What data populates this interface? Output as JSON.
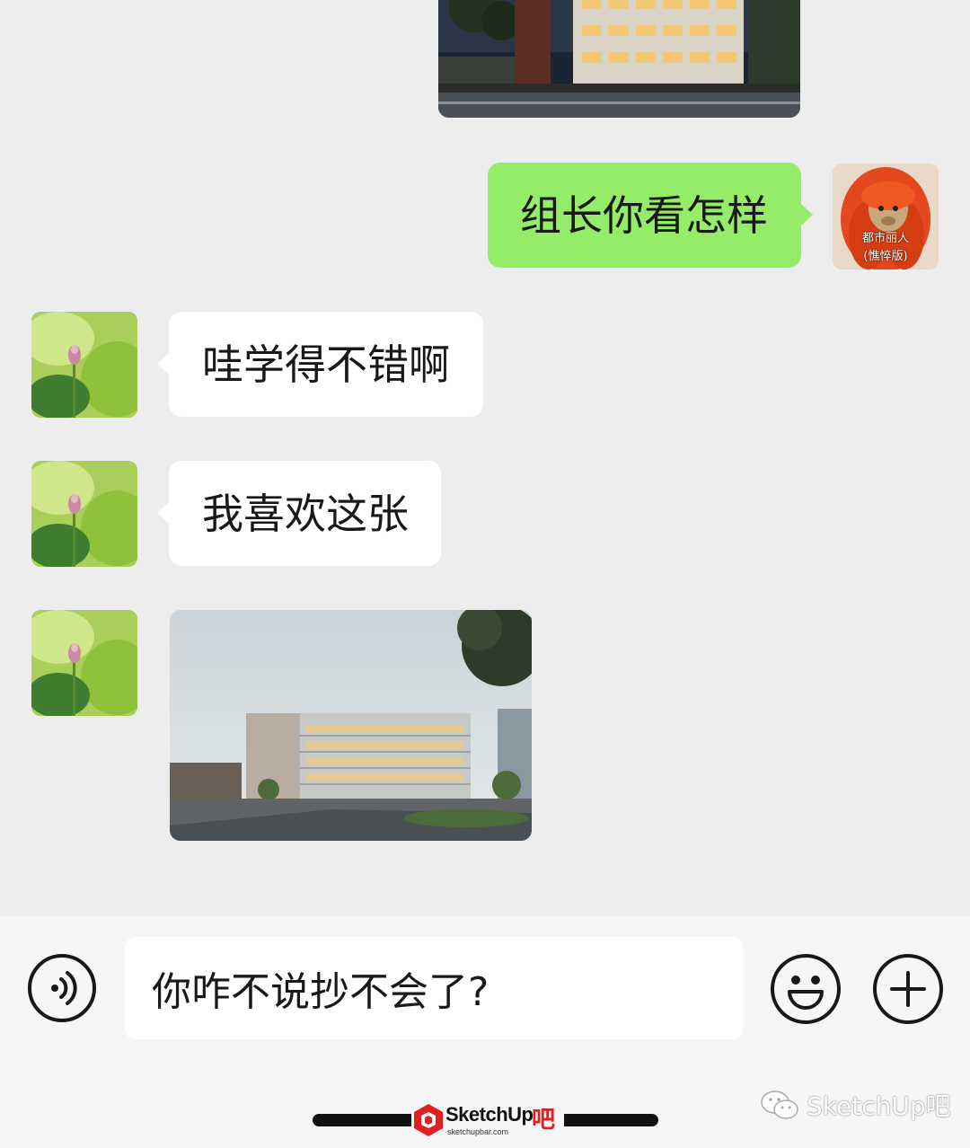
{
  "messages": [
    {
      "from": "me",
      "type": "text",
      "text": "组长你看怎样",
      "sender_caption": "都市丽人\n(憔悴版)"
    },
    {
      "from": "other",
      "type": "text",
      "text": "哇学得不错啊"
    },
    {
      "from": "other",
      "type": "text",
      "text": "我喜欢这张"
    }
  ],
  "my_avatar": {
    "caption_line1": "都市丽人",
    "caption_line2": "(憔悴版)"
  },
  "input": {
    "value": "你咋不说抄不会了?"
  },
  "watermark": {
    "logo": "SketchUp",
    "logo_ba": "吧",
    "logo_sub": "sketchupbar.com",
    "right": "SketchUp吧"
  },
  "colors": {
    "me_bubble": "#95ec69",
    "other_bubble": "#ffffff",
    "background": "#ededed",
    "input_bar": "#f6f6f6"
  },
  "icons": [
    "voice-icon",
    "emoji-icon",
    "plus-icon"
  ]
}
